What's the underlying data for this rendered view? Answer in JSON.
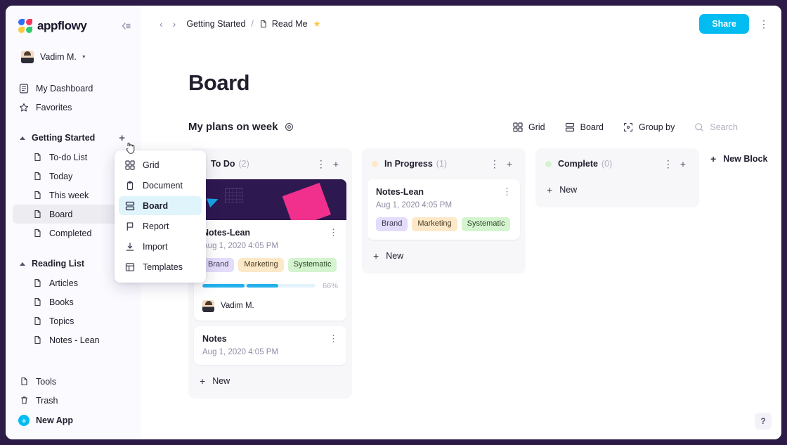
{
  "app": {
    "logo_text": "appflowy",
    "collapse_icon": "collapse-sidebar-icon"
  },
  "user": {
    "name": "Vadim M."
  },
  "sidebar": {
    "top_items": [
      {
        "label": "My Dashboard",
        "icon": "dashboard-icon"
      },
      {
        "label": "Favorites",
        "icon": "star-icon"
      }
    ],
    "groups": [
      {
        "label": "Getting Started",
        "items": [
          {
            "label": "To-do List"
          },
          {
            "label": "Today"
          },
          {
            "label": "This week"
          },
          {
            "label": "Board",
            "selected": true
          },
          {
            "label": "Completed"
          }
        ]
      },
      {
        "label": "Reading List",
        "items": [
          {
            "label": "Articles"
          },
          {
            "label": "Books"
          },
          {
            "label": "Topics"
          },
          {
            "label": "Notes - Lean"
          }
        ]
      }
    ],
    "bottom_items": [
      {
        "label": "Tools",
        "icon": "document-icon"
      },
      {
        "label": "Trash",
        "icon": "trash-icon"
      }
    ],
    "new_app_label": "New App"
  },
  "dropdown": {
    "items": [
      {
        "label": "Grid",
        "icon": "grid-icon",
        "active": false
      },
      {
        "label": "Document",
        "icon": "document-icon",
        "active": false
      },
      {
        "label": "Board",
        "icon": "board-icon",
        "active": true
      },
      {
        "label": "Report",
        "icon": "flag-icon",
        "active": false
      },
      {
        "label": "Import",
        "icon": "import-icon",
        "active": false
      },
      {
        "label": "Templates",
        "icon": "templates-icon",
        "active": false
      }
    ]
  },
  "topbar": {
    "back_icon": "chevron-left-icon",
    "forward_icon": "chevron-right-icon",
    "breadcrumb_parent": "Getting Started",
    "breadcrumb_sep": "/",
    "breadcrumb_current": "Read Me",
    "star_glyph": "★",
    "share_label": "Share",
    "more_glyph": "⋮"
  },
  "page": {
    "title": "Board",
    "view_name": "My plans on week",
    "tools": [
      {
        "label": "Grid",
        "icon": "grid-icon"
      },
      {
        "label": "Board",
        "icon": "board-icon"
      },
      {
        "label": "Group by",
        "icon": "group-by-icon"
      }
    ],
    "search_label": "Search",
    "new_block_label": "New Block",
    "help_label": "?"
  },
  "board": {
    "columns": [
      {
        "title": "To Do",
        "count": "(2)",
        "dot_color": "#fcd9dd",
        "new_label": "New",
        "cards": [
          {
            "has_banner": true,
            "title": "Notes-Lean",
            "date": "Aug 1, 2020 4:05 PM",
            "tags": [
              {
                "label": "Brand",
                "style": "tag-brand"
              },
              {
                "label": "Marketing",
                "style": "tag-marketing"
              },
              {
                "label": "Systematic",
                "style": "tag-systematic"
              }
            ],
            "progress_pct": "66%",
            "assignee": "Vadim M."
          },
          {
            "has_banner": false,
            "title": "Notes",
            "date": "Aug 1, 2020 4:05 PM",
            "tags": [],
            "progress_pct": null,
            "assignee": null
          }
        ]
      },
      {
        "title": "In Progress",
        "count": "(1)",
        "dot_color": "#fde8c8",
        "new_label": "New",
        "cards": [
          {
            "has_banner": false,
            "title": "Notes-Lean",
            "date": "Aug 1, 2020 4:05 PM",
            "tags": [
              {
                "label": "Brand",
                "style": "tag-brand"
              },
              {
                "label": "Marketing",
                "style": "tag-marketing"
              },
              {
                "label": "Systematic",
                "style": "tag-systematic"
              }
            ],
            "progress_pct": null,
            "assignee": null
          }
        ]
      },
      {
        "title": "Complete",
        "count": "(0)",
        "dot_color": "#d4f4cf",
        "new_label": "New",
        "cards": []
      }
    ]
  },
  "colors": {
    "accent": "#00bcf0",
    "frame": "#2d1b47",
    "sidebar_bg": "#fafaff",
    "column_bg": "#f7f7fa",
    "banner_bg": "#2d1850",
    "banner_shape": "#f0308c",
    "progress": "#23b0ec"
  }
}
